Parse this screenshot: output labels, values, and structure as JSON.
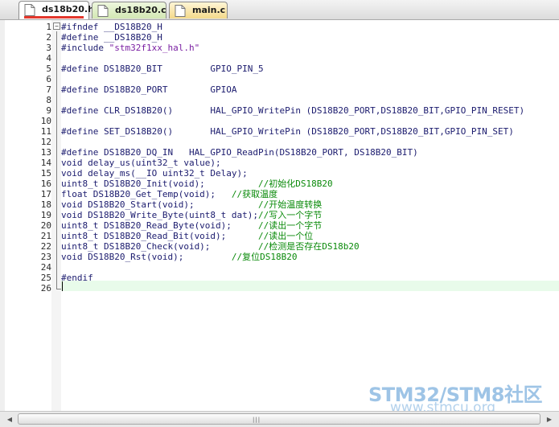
{
  "tabs": [
    {
      "label": "ds18b20.h",
      "active": true
    },
    {
      "label": "ds18b20.c",
      "active": false
    },
    {
      "label": "main.c",
      "active": false
    }
  ],
  "editor": {
    "lines": [
      {
        "num": "1",
        "text": "#ifndef __DS18B20_H"
      },
      {
        "num": "2",
        "text": "#define __DS18B20_H"
      },
      {
        "num": "3",
        "text": "#include \"stm32f1xx_hal.h\""
      },
      {
        "num": "4",
        "text": ""
      },
      {
        "num": "5",
        "text": "#define DS18B20_BIT         GPIO_PIN_5"
      },
      {
        "num": "6",
        "text": ""
      },
      {
        "num": "7",
        "text": "#define DS18B20_PORT        GPIOA"
      },
      {
        "num": "8",
        "text": ""
      },
      {
        "num": "9",
        "text": "#define CLR_DS18B20()       HAL_GPIO_WritePin (DS18B20_PORT,DS18B20_BIT,GPIO_PIN_RESET)"
      },
      {
        "num": "10",
        "text": ""
      },
      {
        "num": "11",
        "text": "#define SET_DS18B20()       HAL_GPIO_WritePin (DS18B20_PORT,DS18B20_BIT,GPIO_PIN_SET)"
      },
      {
        "num": "12",
        "text": ""
      },
      {
        "num": "13",
        "text": "#define DS18B20_DQ_IN   HAL_GPIO_ReadPin(DS18B20_PORT, DS18B20_BIT)"
      },
      {
        "num": "14",
        "text": "void delay_us(uint32_t value);"
      },
      {
        "num": "15",
        "text": "void delay_ms(__IO uint32_t Delay);"
      },
      {
        "num": "16",
        "code": "uint8_t DS18B20_Init(void);          ",
        "comment": "//初始化DS18B20"
      },
      {
        "num": "17",
        "code": "float DS18B20_Get_Temp(void);   ",
        "comment": "//获取温度"
      },
      {
        "num": "18",
        "code": "void DS18B20_Start(void);            ",
        "comment": "//开始温度转换"
      },
      {
        "num": "19",
        "code": "void DS18B20_Write_Byte(uint8_t dat);",
        "comment": "//写入一个字节"
      },
      {
        "num": "20",
        "code": "uint8_t DS18B20_Read_Byte(void);     ",
        "comment": "//读出一个字节"
      },
      {
        "num": "21",
        "code": "uint8_t DS18B20_Read_Bit(void);      ",
        "comment": "//读出一个位"
      },
      {
        "num": "22",
        "code": "uint8_t DS18B20_Check(void);         ",
        "comment": "//检测是否存在DS18b20"
      },
      {
        "num": "23",
        "code": "void DS18B20_Rst(void);         ",
        "comment": "//复位DS18B20"
      },
      {
        "num": "24",
        "text": ""
      },
      {
        "num": "25",
        "text": "#endif"
      },
      {
        "num": "26",
        "text": ""
      }
    ]
  },
  "watermark": {
    "line1": "STM32/STM8社区",
    "line2": "www.stmcu.org"
  },
  "scrollbar": {
    "grip": "|||"
  },
  "colors": {
    "comment": "#0a8a0a",
    "string": "#7a1fa2",
    "keyword": "#1b1b6e",
    "current_line": "#e8fbea",
    "active_tab_marker": "#e3372c"
  }
}
